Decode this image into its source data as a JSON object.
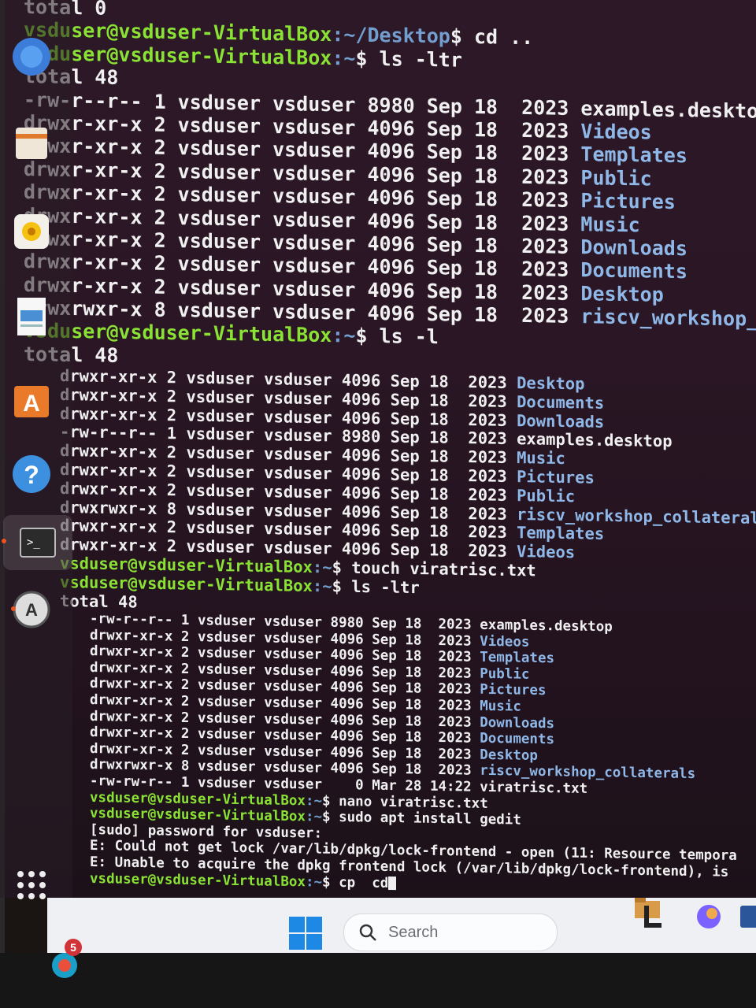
{
  "terminal": {
    "lines_upper": [
      {
        "type": "plain",
        "text": "total 0"
      },
      {
        "type": "prompt",
        "user": "vsduser@vsduser-VirtualBox",
        "path": ":~/Desktop",
        "cmd": "$ cd .."
      },
      {
        "type": "prompt",
        "user": "vsduser@vsduser-VirtualBox",
        "path": ":~",
        "cmd": "$ ls -ltr"
      },
      {
        "type": "plain",
        "text": "total 48"
      },
      {
        "type": "entry",
        "meta": "-rw-r--r-- 1 vsduser vsduser 8980 Sep 18  2023 ",
        "name": "examples.desktop",
        "dir": false
      },
      {
        "type": "entry",
        "meta": "drwxr-xr-x 2 vsduser vsduser 4096 Sep 18  2023 ",
        "name": "Videos",
        "dir": true
      },
      {
        "type": "entry",
        "meta": "drwxr-xr-x 2 vsduser vsduser 4096 Sep 18  2023 ",
        "name": "Templates",
        "dir": true
      },
      {
        "type": "entry",
        "meta": "drwxr-xr-x 2 vsduser vsduser 4096 Sep 18  2023 ",
        "name": "Public",
        "dir": true
      },
      {
        "type": "entry",
        "meta": "drwxr-xr-x 2 vsduser vsduser 4096 Sep 18  2023 ",
        "name": "Pictures",
        "dir": true
      },
      {
        "type": "entry",
        "meta": "drwxr-xr-x 2 vsduser vsduser 4096 Sep 18  2023 ",
        "name": "Music",
        "dir": true
      },
      {
        "type": "entry",
        "meta": "drwxr-xr-x 2 vsduser vsduser 4096 Sep 18  2023 ",
        "name": "Downloads",
        "dir": true
      },
      {
        "type": "entry",
        "meta": "drwxr-xr-x 2 vsduser vsduser 4096 Sep 18  2023 ",
        "name": "Documents",
        "dir": true
      },
      {
        "type": "entry",
        "meta": "drwxr-xr-x 2 vsduser vsduser 4096 Sep 18  2023 ",
        "name": "Desktop",
        "dir": true
      },
      {
        "type": "entry",
        "meta": "drwxrwxr-x 8 vsduser vsduser 4096 Sep 18  2023 ",
        "name": "riscv_workshop_collate",
        "dir": true
      },
      {
        "type": "prompt",
        "user": "vsduser@vsduser-VirtualBox",
        "path": ":~",
        "cmd": "$ ls -l"
      },
      {
        "type": "plain",
        "text": "total 48"
      }
    ],
    "lines_middle": [
      {
        "type": "entry",
        "meta": "drwxr-xr-x 2 vsduser vsduser 4096 Sep 18  2023 ",
        "name": "Desktop",
        "dir": true
      },
      {
        "type": "entry",
        "meta": "drwxr-xr-x 2 vsduser vsduser 4096 Sep 18  2023 ",
        "name": "Documents",
        "dir": true
      },
      {
        "type": "entry",
        "meta": "drwxr-xr-x 2 vsduser vsduser 4096 Sep 18  2023 ",
        "name": "Downloads",
        "dir": true
      },
      {
        "type": "entry",
        "meta": "-rw-r--r-- 1 vsduser vsduser 8980 Sep 18  2023 ",
        "name": "examples.desktop",
        "dir": false
      },
      {
        "type": "entry",
        "meta": "drwxr-xr-x 2 vsduser vsduser 4096 Sep 18  2023 ",
        "name": "Music",
        "dir": true
      },
      {
        "type": "entry",
        "meta": "drwxr-xr-x 2 vsduser vsduser 4096 Sep 18  2023 ",
        "name": "Pictures",
        "dir": true
      },
      {
        "type": "entry",
        "meta": "drwxr-xr-x 2 vsduser vsduser 4096 Sep 18  2023 ",
        "name": "Public",
        "dir": true
      },
      {
        "type": "entry",
        "meta": "drwxrwxr-x 8 vsduser vsduser 4096 Sep 18  2023 ",
        "name": "riscv_workshop_collateral",
        "dir": true
      },
      {
        "type": "entry",
        "meta": "drwxr-xr-x 2 vsduser vsduser 4096 Sep 18  2023 ",
        "name": "Templates",
        "dir": true
      },
      {
        "type": "entry",
        "meta": "drwxr-xr-x 2 vsduser vsduser 4096 Sep 18  2023 ",
        "name": "Videos",
        "dir": true
      },
      {
        "type": "prompt",
        "user": "vsduser@vsduser-VirtualBox",
        "path": ":~",
        "cmd": "$ touch viratrisc.txt"
      },
      {
        "type": "prompt",
        "user": "vsduser@vsduser-VirtualBox",
        "path": ":~",
        "cmd": "$ ls -ltr"
      },
      {
        "type": "plain",
        "text": "total 48"
      }
    ],
    "lines_lower": [
      {
        "type": "entry",
        "meta": "-rw-r--r-- 1 vsduser vsduser 8980 Sep 18  2023 ",
        "name": "examples.desktop",
        "dir": false
      },
      {
        "type": "entry",
        "meta": "drwxr-xr-x 2 vsduser vsduser 4096 Sep 18  2023 ",
        "name": "Videos",
        "dir": true
      },
      {
        "type": "entry",
        "meta": "drwxr-xr-x 2 vsduser vsduser 4096 Sep 18  2023 ",
        "name": "Templates",
        "dir": true
      },
      {
        "type": "entry",
        "meta": "drwxr-xr-x 2 vsduser vsduser 4096 Sep 18  2023 ",
        "name": "Public",
        "dir": true
      },
      {
        "type": "entry",
        "meta": "drwxr-xr-x 2 vsduser vsduser 4096 Sep 18  2023 ",
        "name": "Pictures",
        "dir": true
      },
      {
        "type": "entry",
        "meta": "drwxr-xr-x 2 vsduser vsduser 4096 Sep 18  2023 ",
        "name": "Music",
        "dir": true
      },
      {
        "type": "entry",
        "meta": "drwxr-xr-x 2 vsduser vsduser 4096 Sep 18  2023 ",
        "name": "Downloads",
        "dir": true
      },
      {
        "type": "entry",
        "meta": "drwxr-xr-x 2 vsduser vsduser 4096 Sep 18  2023 ",
        "name": "Documents",
        "dir": true
      },
      {
        "type": "entry",
        "meta": "drwxr-xr-x 2 vsduser vsduser 4096 Sep 18  2023 ",
        "name": "Desktop",
        "dir": true
      },
      {
        "type": "entry",
        "meta": "drwxrwxr-x 8 vsduser vsduser 4096 Sep 18  2023 ",
        "name": "riscv_workshop_collaterals",
        "dir": true
      },
      {
        "type": "entry",
        "meta": "-rw-rw-r-- 1 vsduser vsduser    0 Mar 28 14:22 ",
        "name": "viratrisc.txt",
        "dir": false
      },
      {
        "type": "prompt",
        "user": "vsduser@vsduser-VirtualBox",
        "path": ":~",
        "cmd": "$ nano viratrisc.txt"
      },
      {
        "type": "prompt",
        "user": "vsduser@vsduser-VirtualBox",
        "path": ":~",
        "cmd": "$ sudo apt install gedit"
      },
      {
        "type": "plain",
        "text": "[sudo] password for vsduser:"
      },
      {
        "type": "plain",
        "text": "E: Could not get lock /var/lib/dpkg/lock-frontend - open (11: Resource tempora"
      },
      {
        "type": "plain",
        "text": "E: Unable to acquire the dpkg frontend lock (/var/lib/dpkg/lock-frontend), is"
      },
      {
        "type": "prompt",
        "user": "vsduser@vsduser-VirtualBox",
        "path": ":~",
        "cmd": "$ cp  cd",
        "cursor": true
      }
    ]
  },
  "dock": {
    "items": [
      {
        "name": "firefox-icon"
      },
      {
        "name": "files-icon"
      },
      {
        "name": "rhythmbox-icon"
      },
      {
        "name": "libreoffice-writer-icon"
      },
      {
        "name": "software-center-icon"
      },
      {
        "name": "help-icon"
      },
      {
        "name": "terminal-icon"
      },
      {
        "name": "software-updater-icon"
      },
      {
        "name": "show-applications-icon"
      }
    ]
  },
  "taskbar": {
    "search_label": "Search",
    "notification_count": "5"
  },
  "colors": {
    "prompt_user": "#8ae234",
    "prompt_path": "#729fcf",
    "directory": "#8fb8e8",
    "terminal_bg": "#2c1826"
  }
}
